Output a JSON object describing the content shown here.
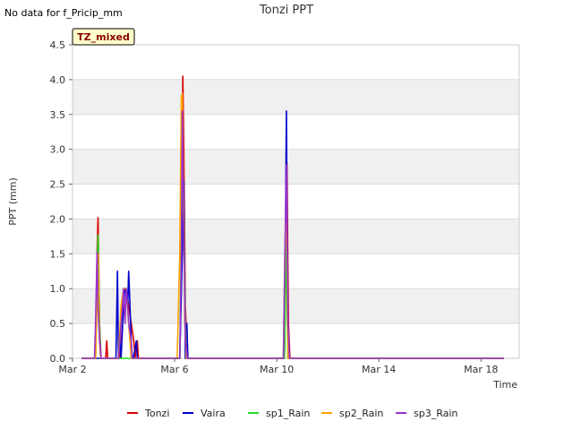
{
  "header": {
    "note": "No data for f_Pricip_mm",
    "badge": "TZ_mixed"
  },
  "colors": {
    "Tonzi": "#dd0000",
    "Vaira": "#0000cc",
    "sp1_Rain": "#22dd22",
    "sp2_Rain": "#ffa500",
    "sp3_Rain": "#9932cc",
    "band": "#f0f0f0",
    "grid": "#dddddd"
  },
  "chart_data": {
    "type": "line",
    "title": "Tonzi PPT",
    "xlabel": "Time",
    "ylabel": "PPT (mm)",
    "x_unit": "days since Mar 2",
    "xlim": [
      0,
      17.5
    ],
    "ylim": [
      0,
      4.5
    ],
    "x_ticks": [
      {
        "value": 0,
        "label": "Mar 2"
      },
      {
        "value": 4,
        "label": "Mar 6"
      },
      {
        "value": 8,
        "label": "Mar 10"
      },
      {
        "value": 12,
        "label": "Mar 14"
      },
      {
        "value": 16,
        "label": "Mar 18"
      }
    ],
    "y_ticks": [
      {
        "value": 0,
        "label": "0.0"
      },
      {
        "value": 0.5,
        "label": "0.5"
      },
      {
        "value": 1.0,
        "label": "1.0"
      },
      {
        "value": 1.5,
        "label": "1.5"
      },
      {
        "value": 2.0,
        "label": "2.0"
      },
      {
        "value": 2.5,
        "label": "2.5"
      },
      {
        "value": 3.0,
        "label": "3.0"
      },
      {
        "value": 3.5,
        "label": "3.5"
      },
      {
        "value": 4.0,
        "label": "4.0"
      },
      {
        "value": 4.5,
        "label": "4.5"
      }
    ],
    "legend": [
      "Tonzi",
      "Vaira",
      "sp1_Rain",
      "sp2_Rain",
      "sp3_Rain"
    ],
    "legend_position": "bottom",
    "series": [
      {
        "name": "Tonzi",
        "x": [
          0.35,
          0.9,
          0.96,
          1.0,
          1.06,
          1.12,
          1.2,
          1.3,
          1.34,
          1.38,
          1.5,
          1.85,
          1.9,
          2.0,
          2.1,
          2.2,
          2.3,
          2.4,
          2.46,
          2.5,
          2.54,
          2.58,
          2.7,
          4.2,
          4.28,
          4.32,
          4.36,
          4.42,
          4.5,
          4.6,
          8.3,
          8.36,
          8.4,
          8.46,
          8.52,
          8.6,
          16.9
        ],
        "y": [
          0,
          0,
          1.5,
          2.02,
          0.5,
          0,
          0,
          0,
          0.25,
          0,
          0,
          0,
          0.5,
          1.0,
          1.0,
          0.75,
          0.5,
          0.25,
          0,
          0.25,
          0.25,
          0,
          0,
          0,
          1.5,
          4.05,
          3.0,
          0.75,
          0,
          0,
          0,
          1.5,
          2.8,
          0.5,
          0,
          0,
          0
        ]
      },
      {
        "name": "Vaira",
        "x": [
          0.35,
          1.7,
          1.76,
          1.8,
          1.86,
          1.9,
          2.0,
          2.05,
          2.1,
          2.16,
          2.2,
          2.3,
          2.34,
          2.38,
          2.5,
          2.54,
          2.58,
          4.2,
          4.3,
          4.36,
          4.42,
          4.48,
          4.52,
          4.56,
          8.3,
          8.38,
          8.43,
          8.48,
          16.9
        ],
        "y": [
          0,
          0,
          1.25,
          0,
          0.25,
          0,
          0.75,
          1.0,
          1.0,
          0.75,
          1.25,
          0.25,
          0,
          0,
          0.25,
          0,
          0,
          0,
          1.5,
          2.55,
          0,
          0.5,
          0,
          0,
          0,
          3.55,
          0.25,
          0,
          0
        ]
      },
      {
        "name": "sp1_Rain",
        "x": [
          0.35,
          0.9,
          0.96,
          1.0,
          1.06,
          1.1,
          4.2,
          4.3,
          4.36,
          4.42,
          4.46,
          8.3,
          8.38,
          8.43,
          16.9
        ],
        "y": [
          0,
          0,
          1.25,
          1.77,
          0.5,
          0,
          0,
          2.8,
          2.03,
          0.5,
          0,
          0,
          1.75,
          0,
          0
        ]
      },
      {
        "name": "sp2_Rain",
        "x": [
          0.35,
          0.9,
          0.96,
          1.0,
          1.06,
          1.1,
          1.8,
          1.9,
          2.0,
          2.1,
          2.2,
          2.3,
          2.4,
          4.1,
          4.2,
          4.26,
          4.3,
          4.34,
          4.4,
          4.46,
          8.26,
          8.32,
          8.38,
          8.44,
          16.9
        ],
        "y": [
          0,
          0,
          0.75,
          1.5,
          0.25,
          0,
          0,
          0.75,
          1.0,
          1.0,
          0.5,
          0,
          0,
          0,
          1.5,
          3.75,
          3.8,
          2.5,
          0.5,
          0,
          0,
          1.5,
          2.3,
          0,
          0
        ]
      },
      {
        "name": "sp3_Rain",
        "x": [
          0.35,
          0.86,
          0.9,
          0.96,
          1.0,
          1.06,
          1.12,
          1.2,
          1.8,
          1.86,
          1.9,
          1.96,
          2.0,
          2.06,
          2.1,
          2.16,
          2.2,
          2.3,
          2.34,
          2.4,
          4.2,
          4.26,
          4.3,
          4.36,
          4.42,
          4.5,
          8.26,
          8.32,
          8.38,
          8.44,
          8.5,
          16.9
        ],
        "y": [
          0,
          0,
          0.5,
          1.52,
          0.75,
          0.25,
          0,
          0,
          0,
          0.25,
          0.5,
          0.75,
          1.0,
          0.5,
          1.0,
          0.75,
          0.5,
          0.25,
          0,
          0,
          0,
          1.5,
          3.55,
          1.75,
          0.25,
          0,
          0,
          1.5,
          2.78,
          0.5,
          0,
          0
        ]
      }
    ]
  }
}
